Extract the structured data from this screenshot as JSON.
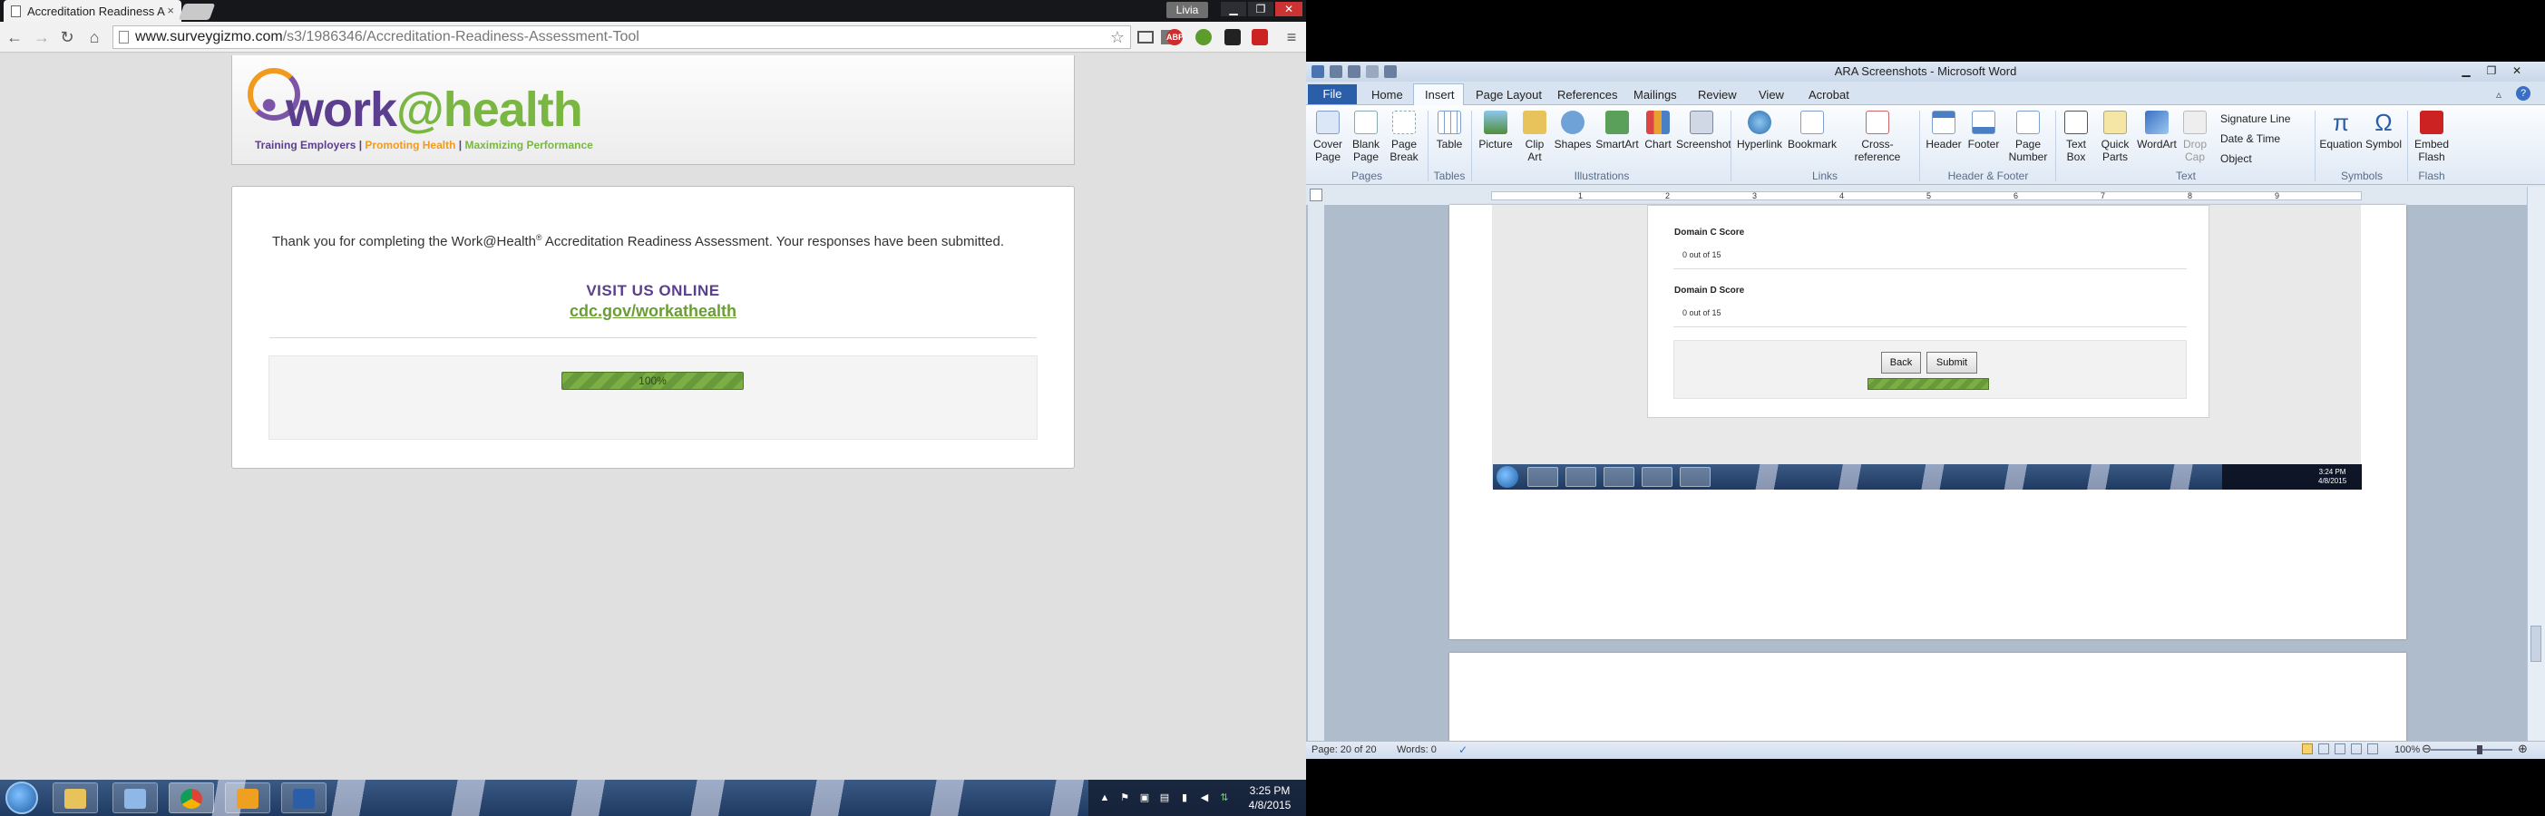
{
  "chrome": {
    "tab_title": "Accreditation Readiness A",
    "tab_close": "×",
    "profile": "Livia",
    "url_domain": "www.surveygizmo.com",
    "url_path": "/s3/1986346/Accreditation-Readiness-Assessment-Tool",
    "ext_abp": "ABP"
  },
  "page": {
    "logo_work": "work",
    "logo_at_health": "@health",
    "tagline_1": "Training Employers",
    "tagline_sep": " | ",
    "tagline_2": "Promoting Health",
    "tagline_3": "Maximizing Performance",
    "thanks_prefix": "Thank you for completing the Work@Health",
    "thanks_reg": "®",
    "thanks_suffix": " Accreditation Readiness Assessment. Your responses have been submitted.",
    "visit_label": "VISIT US ONLINE",
    "cdc_link": "cdc.gov/workathealth",
    "progress_text": "100%",
    "progress_value": 100
  },
  "left_taskbar": {
    "time": "3:25 PM",
    "date": "4/8/2015"
  },
  "word": {
    "title": "ARA Screenshots - Microsoft Word",
    "file_tab": "File",
    "tabs": [
      "Home",
      "Insert",
      "Page Layout",
      "References",
      "Mailings",
      "Review",
      "View",
      "Acrobat"
    ],
    "ribbon": {
      "cover_page": "Cover Page",
      "blank_page": "Blank Page",
      "page_break": "Page Break",
      "table": "Table",
      "picture": "Picture",
      "clip_art": "Clip Art",
      "shapes": "Shapes",
      "smartart": "SmartArt",
      "chart": "Chart",
      "screenshot": "Screenshot",
      "hyperlink": "Hyperlink",
      "bookmark": "Bookmark",
      "cross_reference": "Cross-reference",
      "header": "Header",
      "footer": "Footer",
      "page_number": "Page Number",
      "text_box": "Text Box",
      "quick_parts": "Quick Parts",
      "wordart": "WordArt",
      "drop_cap": "Drop Cap",
      "signature_line": "Signature Line",
      "date_time": "Date & Time",
      "object": "Object",
      "equation": "Equation",
      "symbol": "Symbol",
      "embed_flash": "Embed Flash"
    },
    "groups": {
      "pages": "Pages",
      "tables": "Tables",
      "illustrations": "Illustrations",
      "links": "Links",
      "header_footer": "Header & Footer",
      "text": "Text",
      "symbols": "Symbols",
      "flash": "Flash"
    },
    "ruler_numbers": [
      "1",
      "2",
      "3",
      "4",
      "5",
      "6",
      "7",
      "8",
      "9"
    ],
    "embedded": {
      "domain_c_label": "Domain C Score",
      "domain_c_score": "0 out of 15",
      "domain_d_label": "Domain D Score",
      "domain_d_score": "0 out of 15",
      "back_button": "Back",
      "submit_button": "Submit",
      "time": "3:24 PM",
      "date": "4/8/2015"
    },
    "status": {
      "page": "Page: 20 of 20",
      "words": "Words: 0",
      "zoom": "100%"
    }
  },
  "colors": {
    "brand_purple": "#5b3f8e",
    "brand_orange": "#f29a1d",
    "brand_green": "#7ab642",
    "word_blue": "#2a5ea8"
  }
}
